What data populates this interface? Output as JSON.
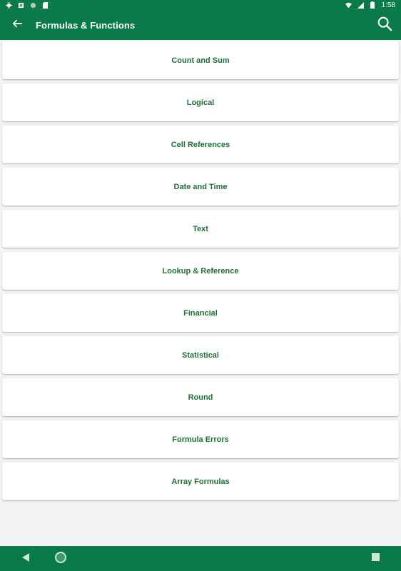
{
  "status_bar": {
    "time": "1:58",
    "left_icons": [
      "gear-icon",
      "clipboard-icon",
      "circle-icon",
      "sd-card-icon"
    ],
    "right_icons": [
      "wifi-icon",
      "signal-icon",
      "battery-icon"
    ]
  },
  "app_bar": {
    "title": "Formulas & Functions",
    "back_icon": "arrow-left-icon",
    "search_icon": "search-icon"
  },
  "categories": [
    {
      "label": "Count and Sum"
    },
    {
      "label": "Logical"
    },
    {
      "label": "Cell References"
    },
    {
      "label": "Date and Time"
    },
    {
      "label": "Text"
    },
    {
      "label": "Lookup & Reference"
    },
    {
      "label": "Financial"
    },
    {
      "label": "Statistical"
    },
    {
      "label": "Round"
    },
    {
      "label": "Formula Errors"
    },
    {
      "label": "Array Formulas"
    }
  ],
  "nav_bar": {
    "back": "triangle-back-icon",
    "home": "circle-home-icon",
    "recents": "square-recents-icon"
  },
  "colors": {
    "primary": "#0b7a4a",
    "item_text": "#1d6f3a",
    "background": "#f1f3f5",
    "card": "#ffffff"
  }
}
